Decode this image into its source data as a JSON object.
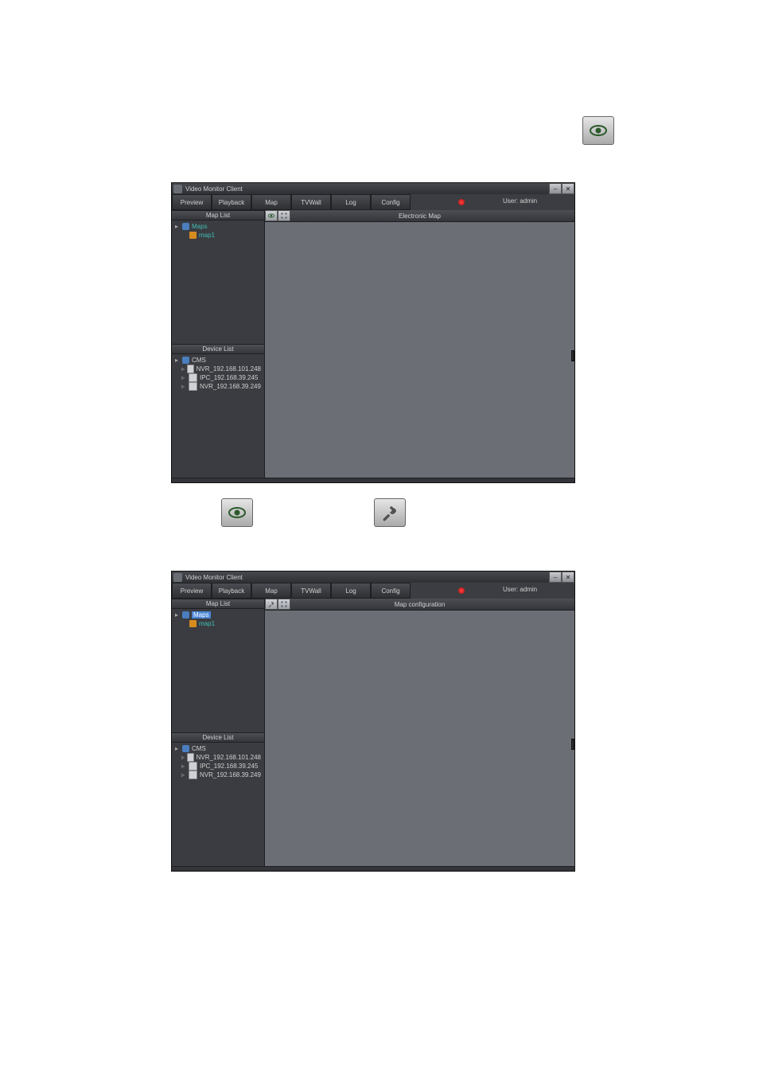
{
  "app_title": "Video Monitor Client",
  "tabs": [
    "Preview",
    "Playback",
    "Map",
    "TVWall",
    "Log",
    "Config"
  ],
  "user_label": "User: admin",
  "sidebar": {
    "map_list_header": "Map List",
    "device_list_header": "Device List",
    "maps_root": "Maps",
    "map_item": "map1",
    "device_root": "CMS",
    "devices": [
      "NVR_192.168.101.248",
      "IPC_192.168.39.245",
      "NVR_192.168.39.249"
    ]
  },
  "main": {
    "electronic_map": "Electronic Map",
    "map_config": "Map configuration"
  },
  "eye_icon": "eye-icon",
  "tools_icon": "tools-icon",
  "fullscreen_icon": "fullscreen-icon"
}
